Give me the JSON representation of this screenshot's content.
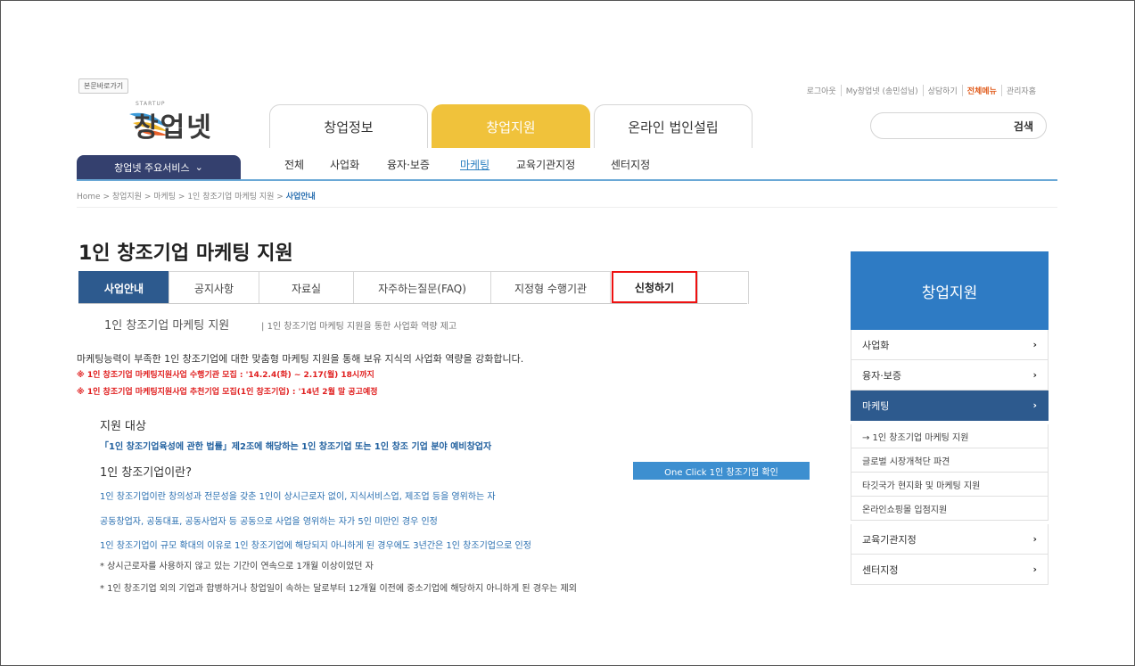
{
  "utility": {
    "skip_link": "본문바로가기",
    "links": [
      "로그아웃",
      "My창업넷 (송민섭님)",
      "상담하기",
      "전체메뉴",
      "관리자홈"
    ]
  },
  "brand": {
    "sub": "STARTUP",
    "name": "창업넷",
    "colors": {
      "yellow": "#f0c23b",
      "blue": "#2e7bc4",
      "navy": "#2d5a8e"
    }
  },
  "main_tabs": [
    "창업정보",
    "창업지원",
    "온라인 법인설립"
  ],
  "search": {
    "label": "검색"
  },
  "services_button": "창업넷 주요서비스",
  "sub_nav": [
    "전체",
    "사업화",
    "융자·보증",
    "마케팅",
    "교육기관지정",
    "센터지정"
  ],
  "breadcrumb": {
    "trail": "Home > 창업지원 > 마케팅 > 1인 창조기업 마케팅 지원 >",
    "current": "사업안내"
  },
  "page_title": "1인 창조기업 마케팅 지원",
  "content_tabs": [
    "사업안내",
    "공지사항",
    "자료실",
    "자주하는질문(FAQ)",
    "지정형 수행기관",
    "신청하기"
  ],
  "section": {
    "title": "1인 창조기업 마케팅 지원",
    "subtitle": "1인 창조기업 마케팅 지원을 통한 사업화 역량 제고"
  },
  "intro": "마케팅능력이 부족한 1인 창조기업에 대한 맞춤형 마케팅 지원을 통해 보유 지식의 사업화 역량을 강화합니다.",
  "notices": [
    "※ 1인 창조기업 마케팅지원사업 수행기관 모집 : '14.2.4(화) ~ 2.17(월) 18시까지",
    "※ 1인 창조기업 마케팅지원사업 추천기업 모집(1인 창조기업) : '14년 2월 말 공고예정"
  ],
  "target": {
    "heading": "지원 대상",
    "law": "「1인 창조기업육성에 관한 법률」제2조에 해당하는 1인 창조기업 또는 1인 창조 기업 분야 예비창업자"
  },
  "definition": {
    "heading": "1인 창조기업이란?",
    "button": "One Click 1인 창조기업 확인",
    "lines": [
      "1인 창조기업이란 창의성과 전문성을 갖춘 1인이 상시근로자 없이, 지식서비스업, 제조업 등을 영위하는 자",
      "공동창업자, 공동대표, 공동사업자 등 공동으로 사업을 영위하는 자가 5인 미만인 경우 인정",
      "1인 창조기업이 규모 확대의 이유로 1인 창조기업에 해당되지 아니하게 된 경우에도 3년간은 1인 창조기업으로 인정"
    ],
    "notes": [
      "* 상시근로자를 사용하지 않고 있는 기간이 연속으로 1개월 이상이었던 자",
      "* 1인 창조기업 외의 기업과 합병하거나 창업일이 속하는 달로부터 12개월 이전에 중소기업에 해당하지 아니하게 된 경우는 제외"
    ]
  },
  "sidebar": {
    "title": "창업지원",
    "items": [
      "사업화",
      "융자·보증",
      "마케팅"
    ],
    "sub_items": [
      "→ 1인 창조기업 마케팅 지원",
      "글로벌 시장개척단 파견",
      "타깃국가 현지화 및 마케팅 지원",
      "온라인쇼핑몰 입점지원"
    ],
    "bottom_items": [
      "교육기관지정",
      "센터지정"
    ]
  }
}
